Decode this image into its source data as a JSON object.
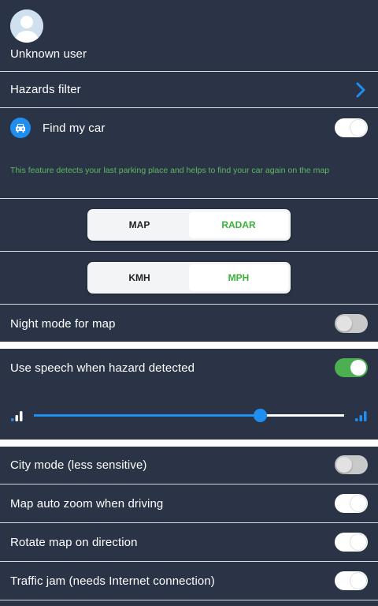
{
  "user": {
    "name": "Unknown user"
  },
  "hazards_filter": {
    "label": "Hazards filter"
  },
  "find_my_car": {
    "label": "Find my car",
    "enabled": false,
    "description": "This feature detects your last parking place and helps to find your car again on the map"
  },
  "view_mode": {
    "options": [
      "MAP",
      "RADAR"
    ],
    "selected": "RADAR"
  },
  "speed_unit": {
    "options": [
      "KMH",
      "MPH"
    ],
    "selected": "MPH"
  },
  "night_mode": {
    "label": "Night mode for map",
    "enabled": false
  },
  "speech": {
    "label": "Use speech when hazard detected",
    "enabled": true,
    "volume_percent": 73
  },
  "city_mode": {
    "label": "City mode (less sensitive)",
    "enabled": false
  },
  "auto_zoom": {
    "label": "Map auto zoom when driving",
    "enabled": false
  },
  "rotate_map": {
    "label": "Rotate map on direction",
    "enabled": false
  },
  "traffic_jam": {
    "label": "Traffic jam (needs Internet connection)",
    "enabled": false
  },
  "colors": {
    "accent_blue": "#1f8ef1",
    "accent_green": "#4caf50",
    "background": "#2a3446"
  },
  "icons": [
    "avatar-placeholder",
    "chevron-right",
    "car",
    "volume-low",
    "volume-high"
  ]
}
